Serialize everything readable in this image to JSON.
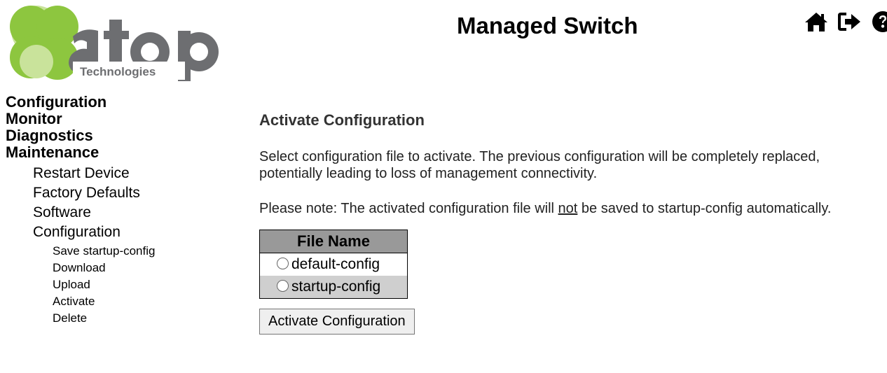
{
  "logo": {
    "brand": "atop",
    "tagline": "Technologies",
    "colors": {
      "green": "#8dc63f",
      "gray": "#6d6e71",
      "light_green": "#c9e39b"
    }
  },
  "header": {
    "title": "Managed Switch",
    "icons": [
      "home-icon",
      "logout-icon",
      "help-icon"
    ]
  },
  "nav": {
    "top": [
      "Configuration",
      "Monitor",
      "Diagnostics",
      "Maintenance"
    ],
    "maintenance_sub": [
      "Restart Device",
      "Factory Defaults",
      "Software",
      "Configuration"
    ],
    "configuration_sub": [
      "Save startup-config",
      "Download",
      "Upload",
      "Activate",
      "Delete"
    ]
  },
  "main": {
    "title": "Activate Configuration",
    "intro": "Select configuration file to activate. The previous configuration will be completely replaced, potentially leading to loss of management connectivity.",
    "note_prefix": "Please note: The activated configuration file will ",
    "note_emph": "not",
    "note_suffix": " be saved to startup-config automatically.",
    "table": {
      "header": "File Name",
      "rows": [
        "default-config",
        "startup-config"
      ]
    },
    "button": "Activate Configuration"
  }
}
